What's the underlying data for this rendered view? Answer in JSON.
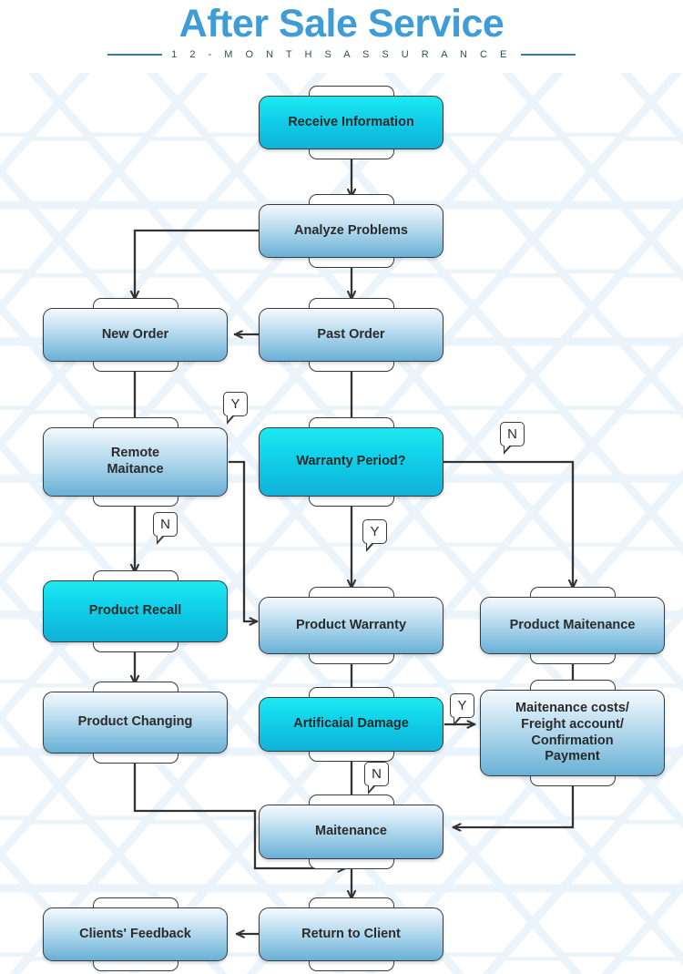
{
  "header": {
    "title": "After Sale Service",
    "subtitle": "1 2 - M O N T H S    A S S U R A N C E"
  },
  "theme": {
    "title_color": "#3e9cd6",
    "rule_color": "#2b7fa8",
    "accent_cyan": "#12c8e4",
    "node_blue_top": "#f2f9fd",
    "node_blue_bottom": "#69b0d6",
    "connector_color": "#333333",
    "background": "#ffffff",
    "hex_pattern_color": "#eaf4fa"
  },
  "chart_data": {
    "type": "diagram",
    "diagram_kind": "flowchart",
    "title": "After Sale Service",
    "nodes": [
      {
        "id": "receive_information",
        "label": "Receive Information",
        "style": "cyan",
        "lines": [
          "Receive Information"
        ]
      },
      {
        "id": "analyze_problems",
        "label": "Analyze Problems",
        "style": "blue",
        "lines": [
          "Analyze Problems"
        ]
      },
      {
        "id": "new_order",
        "label": "New Order",
        "style": "blue",
        "lines": [
          "New Order"
        ]
      },
      {
        "id": "past_order",
        "label": "Past Order",
        "style": "blue",
        "lines": [
          "Past Order"
        ]
      },
      {
        "id": "remote_maitance",
        "label": "Remote Maitance",
        "style": "blue",
        "lines": [
          "Remote",
          "Maitance"
        ]
      },
      {
        "id": "warranty_period",
        "label": "Warranty Period?",
        "style": "cyan",
        "lines": [
          "Warranty Period?"
        ]
      },
      {
        "id": "product_recall",
        "label": "Product Recall",
        "style": "cyan",
        "lines": [
          "Product Recall"
        ]
      },
      {
        "id": "product_warranty",
        "label": "Product Warranty",
        "style": "blue",
        "lines": [
          "Product Warranty"
        ]
      },
      {
        "id": "product_maitenance",
        "label": "Product Maitenance",
        "style": "blue",
        "lines": [
          "Product Maitenance"
        ]
      },
      {
        "id": "product_changing",
        "label": "Product Changing",
        "style": "blue",
        "lines": [
          "Product Changing"
        ]
      },
      {
        "id": "artificaial_damage",
        "label": "Artificaial Damage",
        "style": "cyan",
        "lines": [
          "Artificaial Damage"
        ]
      },
      {
        "id": "maitenance_costs",
        "label": "Maitenance costs/ Freight account/ Confirmation Payment",
        "style": "blue",
        "lines": [
          "Maitenance costs/",
          "Freight account/",
          "Confirmation",
          "Payment"
        ]
      },
      {
        "id": "maitenance",
        "label": "Maitenance",
        "style": "blue",
        "lines": [
          "Maitenance"
        ]
      },
      {
        "id": "clients_feedback",
        "label": "Clients' Feedback",
        "style": "blue",
        "lines": [
          "Clients' Feedback"
        ]
      },
      {
        "id": "return_to_client",
        "label": "Return to Client",
        "style": "blue",
        "lines": [
          "Return to Client"
        ]
      }
    ],
    "edges": [
      {
        "from": "receive_information",
        "to": "analyze_problems",
        "label": ""
      },
      {
        "from": "analyze_problems",
        "to": "new_order",
        "label": ""
      },
      {
        "from": "analyze_problems",
        "to": "past_order",
        "label": ""
      },
      {
        "from": "new_order",
        "to": "past_order",
        "label": "",
        "bidirectional": true
      },
      {
        "from": "new_order",
        "to": "remote_maitance",
        "label": ""
      },
      {
        "from": "past_order",
        "to": "warranty_period",
        "label": ""
      },
      {
        "from": "remote_maitance",
        "to": "product_warranty",
        "label": "Y"
      },
      {
        "from": "remote_maitance",
        "to": "product_recall",
        "label": "N"
      },
      {
        "from": "warranty_period",
        "to": "product_warranty",
        "label": "Y"
      },
      {
        "from": "warranty_period",
        "to": "product_maitenance",
        "label": "N"
      },
      {
        "from": "product_recall",
        "to": "product_changing",
        "label": ""
      },
      {
        "from": "product_warranty",
        "to": "artificaial_damage",
        "label": ""
      },
      {
        "from": "product_maitenance",
        "to": "maitenance_costs",
        "label": ""
      },
      {
        "from": "artificaial_damage",
        "to": "maitenance_costs",
        "label": "Y"
      },
      {
        "from": "artificaial_damage",
        "to": "maitenance",
        "label": "N"
      },
      {
        "from": "maitenance_costs",
        "to": "maitenance",
        "label": ""
      },
      {
        "from": "product_changing",
        "to": "maitenance",
        "label": ""
      },
      {
        "from": "maitenance",
        "to": "return_to_client",
        "label": ""
      },
      {
        "from": "clients_feedback",
        "to": "return_to_client",
        "label": "",
        "bidirectional": true
      }
    ],
    "edge_labels": [
      "Y",
      "N",
      "Y",
      "N",
      "Y",
      "N"
    ]
  }
}
